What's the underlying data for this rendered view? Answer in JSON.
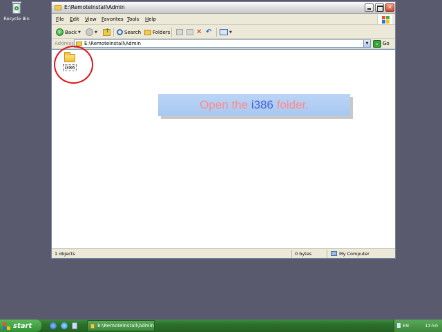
{
  "desktop": {
    "recycle_bin_label": "Recycle Bin"
  },
  "window": {
    "title": "E:\\RemoteInstall\\Admin",
    "menu": [
      "File",
      "Edit",
      "View",
      "Favorites",
      "Tools",
      "Help"
    ],
    "toolbar": {
      "back_label": "Back",
      "search_label": "Search",
      "folders_label": "Folders"
    },
    "address": {
      "label": "Address",
      "value": "E:\\RemoteInstall\\Admin",
      "go_label": "Go"
    },
    "items": [
      {
        "name": "i386",
        "icon": "folder-icon"
      }
    ],
    "status": {
      "objects": "1 objects",
      "size": "0 bytes",
      "location": "My Computer"
    }
  },
  "instruction": {
    "prefix": "Open the ",
    "highlight": "i386",
    "suffix": " folder."
  },
  "taskbar": {
    "start_label": "start",
    "task_label": "E:\\RemoteInstall\\Admin",
    "language": "EN",
    "clock": "13:50"
  },
  "colors": {
    "desktop_bg": "#5a5a6e",
    "taskbar_green": "#2b6f2b",
    "callout_bg": "#b9d4f6",
    "callout_text": "#ff8a8a",
    "callout_highlight": "#4a62d8",
    "highlight_ring": "#e0141a"
  }
}
